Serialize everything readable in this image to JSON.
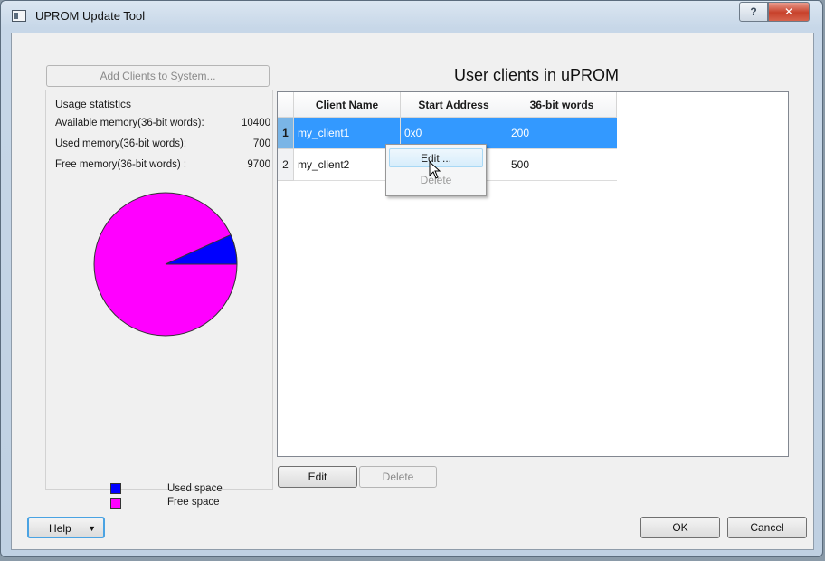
{
  "window": {
    "title": "UPROM Update Tool",
    "help_symbol": "?",
    "close_symbol": "✕"
  },
  "left_panel": {
    "add_clients_label": "Add Clients to System...",
    "stats_title": "Usage statistics",
    "stats": [
      {
        "label": "Available memory(36-bit words):",
        "value": "10400"
      },
      {
        "label": "Used memory(36-bit words):",
        "value": "700"
      },
      {
        "label": "Free memory(36-bit words) :",
        "value": "9700"
      }
    ],
    "pie": {
      "used_fraction": 0.0673,
      "used_color": "#0000ff",
      "free_color": "#ff00ff"
    },
    "legend": [
      {
        "label": "Used space",
        "color": "#0000ff"
      },
      {
        "label": "Free space",
        "color": "#ff00ff"
      }
    ]
  },
  "table": {
    "title": "User clients in uPROM",
    "columns": [
      "Client Name",
      "Start Address",
      "36-bit words"
    ],
    "rows": [
      {
        "index": "1",
        "name": "my_client1",
        "address": "0x0",
        "words": "200",
        "selected": true
      },
      {
        "index": "2",
        "name": "my_client2",
        "address": "",
        "words": "500",
        "selected": false
      }
    ],
    "context_menu": {
      "edit": "Edit ...",
      "delete": "Delete"
    },
    "edit_label": "Edit",
    "delete_label": "Delete"
  },
  "footer": {
    "help_label": "Help",
    "help_arrow": "▼",
    "ok_label": "OK",
    "cancel_label": "Cancel"
  }
}
